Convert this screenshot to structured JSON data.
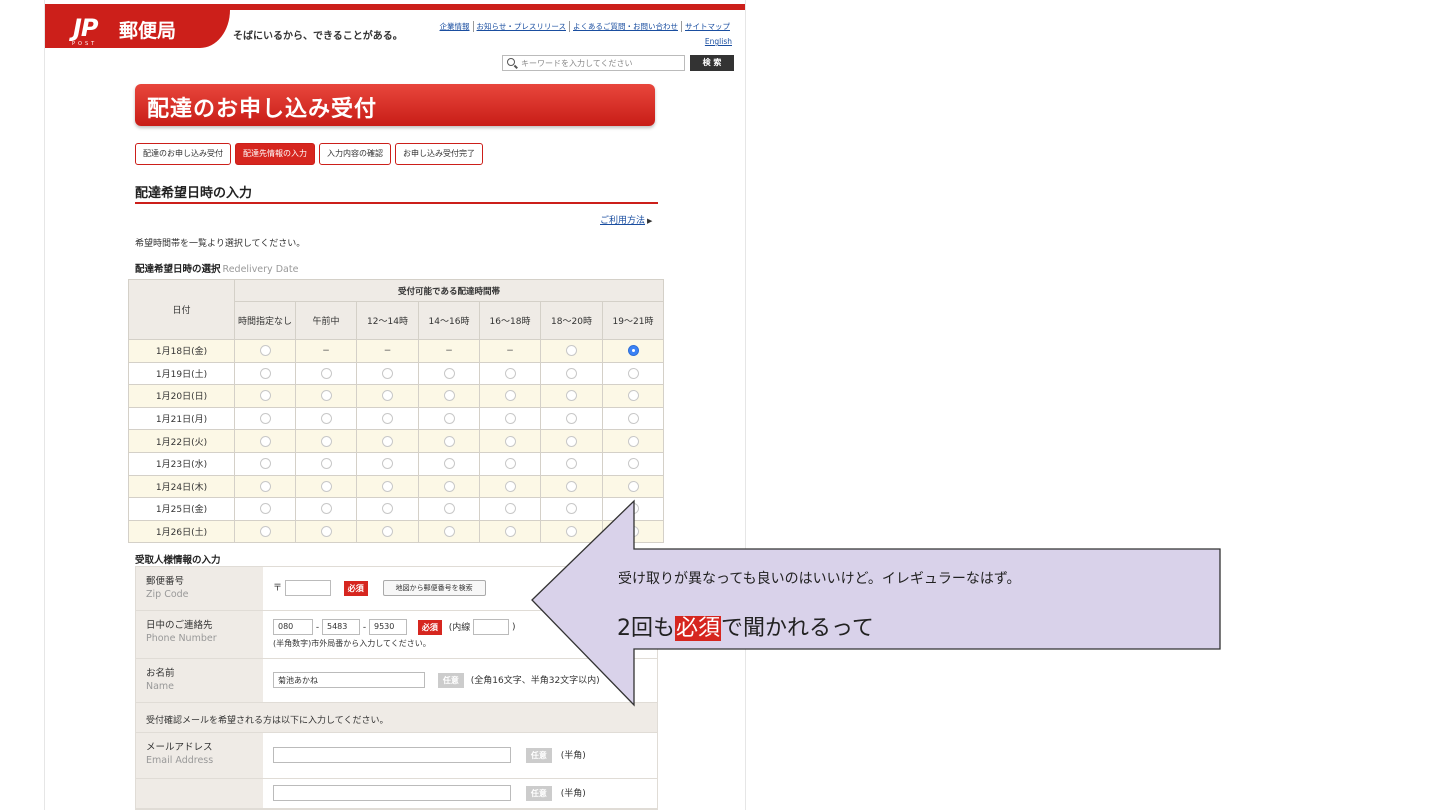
{
  "header": {
    "logo_mark": "JP",
    "logo_sub": "POST",
    "logo_name": "郵便局",
    "tagline": "そばにいるから、できることがある。",
    "links": [
      "企業情報",
      "お知らせ・プレスリリース",
      "よくあるご質問・お問い合わせ",
      "サイトマップ"
    ],
    "english": "English",
    "search_placeholder": "キーワードを入力してください",
    "search_button": "検 索"
  },
  "page": {
    "banner": "配達のお申し込み受付",
    "steps": [
      "配達のお申し込み受付",
      "配達先情報の入力",
      "入力内容の確認",
      "お申し込み受付完了"
    ],
    "active_step": 1,
    "section_title": "配達希望日時の入力",
    "usage_link": "ご利用方法",
    "instruction": "希望時間帯を一覧より選択してください。",
    "datetime_label": "配達希望日時の選択",
    "datetime_label_en": "Redelivery Date"
  },
  "table": {
    "date_header": "日付",
    "group_header": "受付可能である配達時間帯",
    "columns": [
      "時間指定なし",
      "午前中",
      "12〜14時",
      "14〜16時",
      "16〜18時",
      "18〜20時",
      "19〜21時"
    ],
    "rows": [
      {
        "date": "1月18日(金)",
        "cells": [
          "radio",
          "dash",
          "dash",
          "dash",
          "dash",
          "radio",
          "selected"
        ]
      },
      {
        "date": "1月19日(土)",
        "cells": [
          "radio",
          "radio",
          "radio",
          "radio",
          "radio",
          "radio",
          "radio"
        ]
      },
      {
        "date": "1月20日(日)",
        "cells": [
          "radio",
          "radio",
          "radio",
          "radio",
          "radio",
          "radio",
          "radio"
        ]
      },
      {
        "date": "1月21日(月)",
        "cells": [
          "radio",
          "radio",
          "radio",
          "radio",
          "radio",
          "radio",
          "radio"
        ]
      },
      {
        "date": "1月22日(火)",
        "cells": [
          "radio",
          "radio",
          "radio",
          "radio",
          "radio",
          "radio",
          "radio"
        ]
      },
      {
        "date": "1月23日(水)",
        "cells": [
          "radio",
          "radio",
          "radio",
          "radio",
          "radio",
          "radio",
          "radio"
        ]
      },
      {
        "date": "1月24日(木)",
        "cells": [
          "radio",
          "radio",
          "radio",
          "radio",
          "radio",
          "radio",
          "radio"
        ]
      },
      {
        "date": "1月25日(金)",
        "cells": [
          "radio",
          "radio",
          "radio",
          "radio",
          "radio",
          "radio",
          "radio"
        ]
      },
      {
        "date": "1月26日(土)",
        "cells": [
          "radio",
          "radio",
          "radio",
          "radio",
          "radio",
          "radio",
          "radio"
        ]
      }
    ],
    "dash_symbol": "−"
  },
  "recipient": {
    "title": "受取人様情報の入力",
    "zip_label": "郵便番号",
    "zip_label_en": "Zip Code",
    "zip_prefix": "〒",
    "required": "必須",
    "optional": "任意",
    "map_button": "地図から郵便番号を検索",
    "phone_label": "日中のご連絡先",
    "phone_label_en": "Phone Number",
    "phone1": "080",
    "phone2": "5483",
    "phone3": "9530",
    "phone_sep": "-",
    "extension": "(内線",
    "extension_close": ")",
    "phone_note": "(半角数字)市外局番から入力してください。",
    "name_label": "お名前",
    "name_label_en": "Name",
    "name_value": "菊池あかね",
    "name_note": "(全角16文字、半角32文字以内)",
    "mail_notice": "受付確認メールを希望される方は以下に入力してください。",
    "email_label": "メールアドレス",
    "email_label_en": "Email Address",
    "halfwidth": "(半角)",
    "halfwidth2": "(半角)"
  },
  "callout": {
    "line1": "受け取りが異なっても良いのはいいけど。イレギュラーなはず。",
    "line2_pre": "2回も",
    "line2_highlight": "必須",
    "line2_post": "で聞かれるって"
  }
}
